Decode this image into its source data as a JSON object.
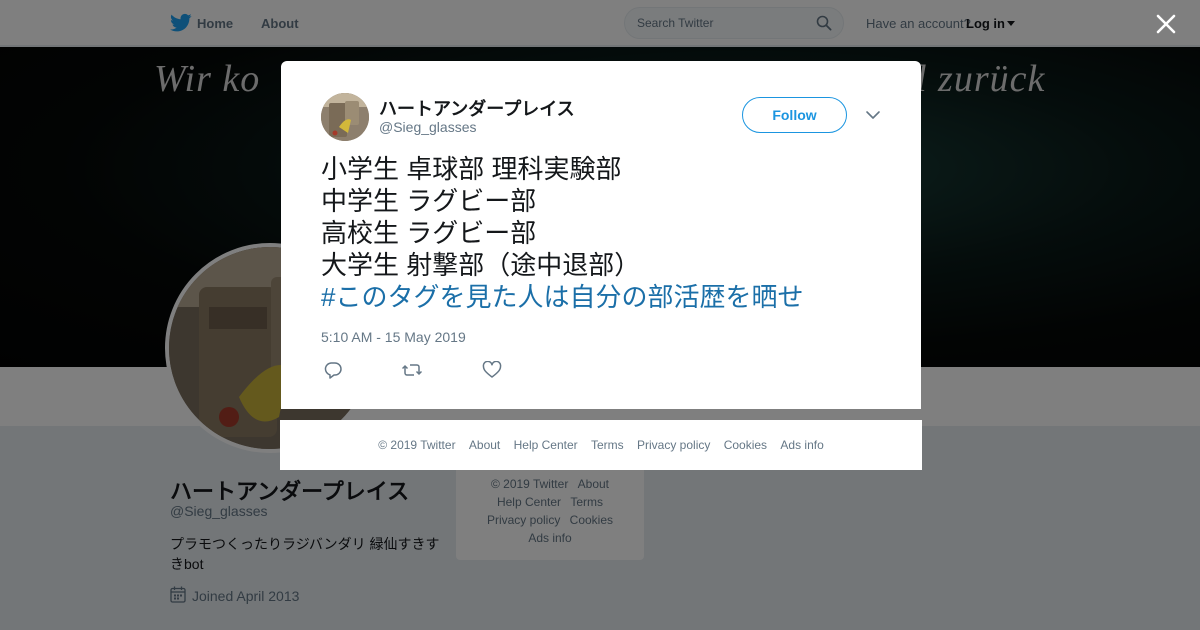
{
  "topbar": {
    "home_label": "Home",
    "about_label": "About",
    "search_placeholder": "Search Twitter",
    "have_account_text": "Have an account?",
    "login_label": "Log in"
  },
  "banner": {
    "text_left": "Wir ko",
    "text_right": "l zurück"
  },
  "profile": {
    "display_name": "ハートアンダープレイス",
    "handle": "@Sieg_glasses",
    "bio": "プラモつくったりラジバンダリ 緑仙すきすきbot",
    "joined": "Joined April 2013"
  },
  "side_footer": {
    "rows": [
      [
        "© 2019 Twitter",
        "About"
      ],
      [
        "Help Center",
        "Terms"
      ],
      [
        "Privacy policy",
        "Cookies"
      ],
      [
        "Ads info"
      ]
    ]
  },
  "modal": {
    "display_name": "ハートアンダープレイス",
    "handle": "@Sieg_glasses",
    "follow_label": "Follow",
    "tweet_lines": [
      "小学生  卓球部 理科実験部",
      "中学生 ラグビー部",
      "高校生 ラグビー部",
      "大学生 射撃部（途中退部）"
    ],
    "hashtag": "#このタグを見た人は自分の部活歴を晒せ",
    "timestamp": "5:10 AM - 15 May 2019"
  },
  "modal_footer": {
    "links": [
      "© 2019 Twitter",
      "About",
      "Help Center",
      "Terms",
      "Privacy policy",
      "Cookies",
      "Ads info"
    ]
  },
  "colors": {
    "twitter_blue": "#1da1f2",
    "follow_blue": "#1b95e0",
    "hashtag_blue": "#1b6fa8",
    "secondary_gray": "#657786",
    "page_bg": "#e6ecf0"
  },
  "icons": [
    "twitter-bird-icon",
    "search-icon",
    "caret-down-icon",
    "close-icon",
    "chevron-down-icon",
    "reply-icon",
    "retweet-icon",
    "heart-icon",
    "calendar-icon"
  ]
}
